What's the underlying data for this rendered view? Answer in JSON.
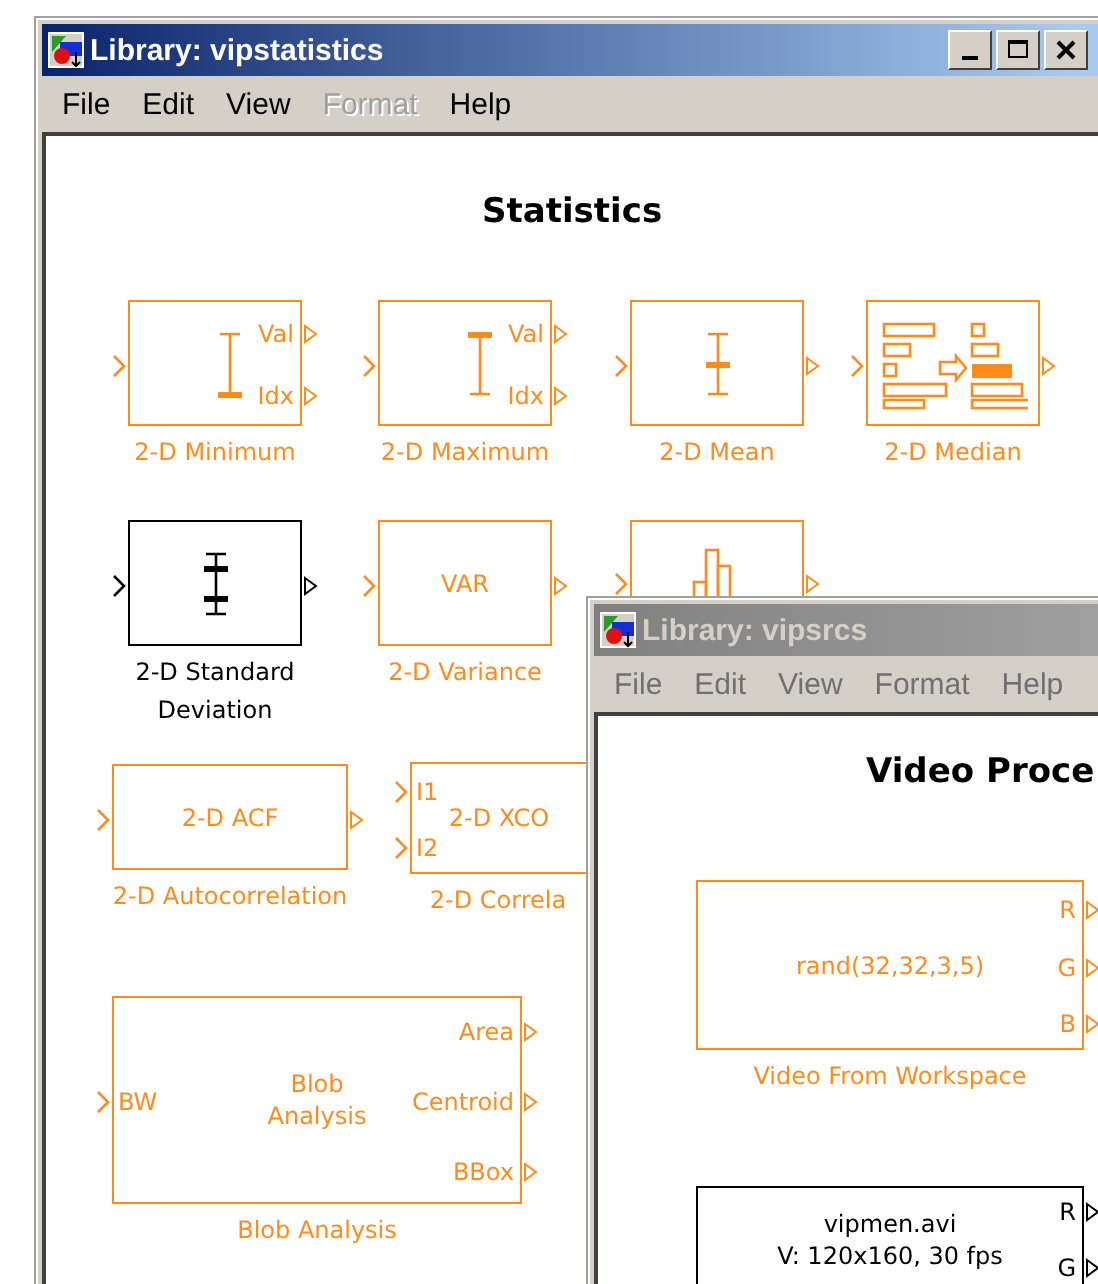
{
  "windows": [
    {
      "title": "Library: vipstatistics",
      "active": true,
      "menu": [
        {
          "label": "File",
          "disabled": false
        },
        {
          "label": "Edit",
          "disabled": false
        },
        {
          "label": "View",
          "disabled": false
        },
        {
          "label": "Format",
          "disabled": true
        },
        {
          "label": "Help",
          "disabled": false
        }
      ],
      "heading": "Statistics",
      "blocks": [
        {
          "kind": "min",
          "label": "2-D Minimum",
          "color": "#ff8c1a",
          "outputs": [
            "Val",
            "Idx"
          ]
        },
        {
          "kind": "max",
          "label": "2-D Maximum",
          "color": "#ff8c1a",
          "outputs": [
            "Val",
            "Idx"
          ]
        },
        {
          "kind": "mean",
          "label": "2-D Mean",
          "color": "#ff8c1a"
        },
        {
          "kind": "median",
          "label": "2-D Median",
          "color": "#ff8c1a"
        },
        {
          "kind": "std",
          "label": "2-D Standard Deviation",
          "color": "#000000"
        },
        {
          "kind": "text",
          "label": "2-D Variance",
          "color": "#ff8c1a",
          "inside": [
            "VAR"
          ]
        },
        {
          "kind": "histogram",
          "color": "#ff8c1a"
        },
        {
          "kind": "text",
          "label": "2-D Autocorrelation",
          "color": "#ff8c1a",
          "inside": [
            "2-D ACF"
          ]
        },
        {
          "kind": "text",
          "label": "2-D Correla",
          "color": "#ff8c1a",
          "inside": [
            "2-D XCO"
          ],
          "inputs": [
            "I1",
            "I2"
          ]
        },
        {
          "kind": "text",
          "label": "Blob Analysis",
          "color": "#ff8c1a",
          "inside": [
            "Blob",
            "Analysis"
          ],
          "inputs": [
            "BW"
          ],
          "outputs": [
            "Area",
            "Centroid",
            "BBox"
          ]
        }
      ]
    },
    {
      "title": "Library: vipsrcs",
      "active": false,
      "menu": [
        {
          "label": "File",
          "disabled": false
        },
        {
          "label": "Edit",
          "disabled": false
        },
        {
          "label": "View",
          "disabled": false
        },
        {
          "label": "Format",
          "disabled": false
        },
        {
          "label": "Help",
          "disabled": false
        }
      ],
      "heading": "Video Proce",
      "blocks": [
        {
          "kind": "source",
          "label": "Video From Workspace",
          "color": "#ff8c1a",
          "inside": [
            "rand(32,32,3,5)"
          ],
          "outputs": [
            "R",
            "G",
            "B"
          ]
        },
        {
          "kind": "source",
          "color": "#000000",
          "inside": [
            "vipmen.avi",
            "V: 120x160, 30 fps"
          ],
          "outputs": [
            "R",
            "G"
          ]
        }
      ]
    }
  ]
}
